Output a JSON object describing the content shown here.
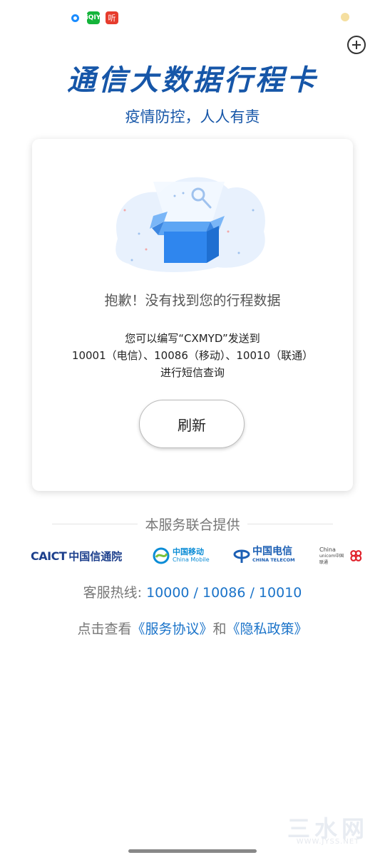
{
  "status_bar": {
    "icons": [
      "circle-app-icon",
      "iqiyi-icon",
      "ting-icon",
      "moon-icon"
    ],
    "iqiyi_text": "iQIY",
    "ting_text": "听"
  },
  "header": {
    "title": "通信大数据行程卡",
    "subtitle": "疫情防控，人人有责",
    "add_icon": "plus-circle-icon"
  },
  "card": {
    "empty_message": "抱歉！没有找到您的行程数据",
    "hint_line1": "您可以编写“CXMYD”发送到",
    "hint_line2": "10001（电信）、10086（移动）、10010（联通）",
    "hint_line3": "进行短信查询",
    "refresh_label": "刷新"
  },
  "providers": {
    "label": "本服务联合提供",
    "caict_en": "CAICT",
    "caict_cn": "中国信通院",
    "cmobile_cn": "中国移动",
    "cmobile_en": "China Mobile",
    "ctelecom_cn": "中国电信",
    "ctelecom_en": "CHINA TELECOM",
    "cunicom_en1": "China",
    "cunicom_en2": "unicom中国联通"
  },
  "hotline": {
    "label": "客服热线: ",
    "numbers": "10000 / 10086 / 10010"
  },
  "policy": {
    "prefix": "点击查看",
    "service_agreement": "《服务协议》",
    "connector": "和",
    "privacy_policy": "《隐私政策》"
  },
  "watermark": {
    "text": "三水网",
    "url": "WWW.JYSS.NET"
  },
  "colors": {
    "brand_blue": "#1656a8",
    "link_blue": "#1a73c9"
  }
}
